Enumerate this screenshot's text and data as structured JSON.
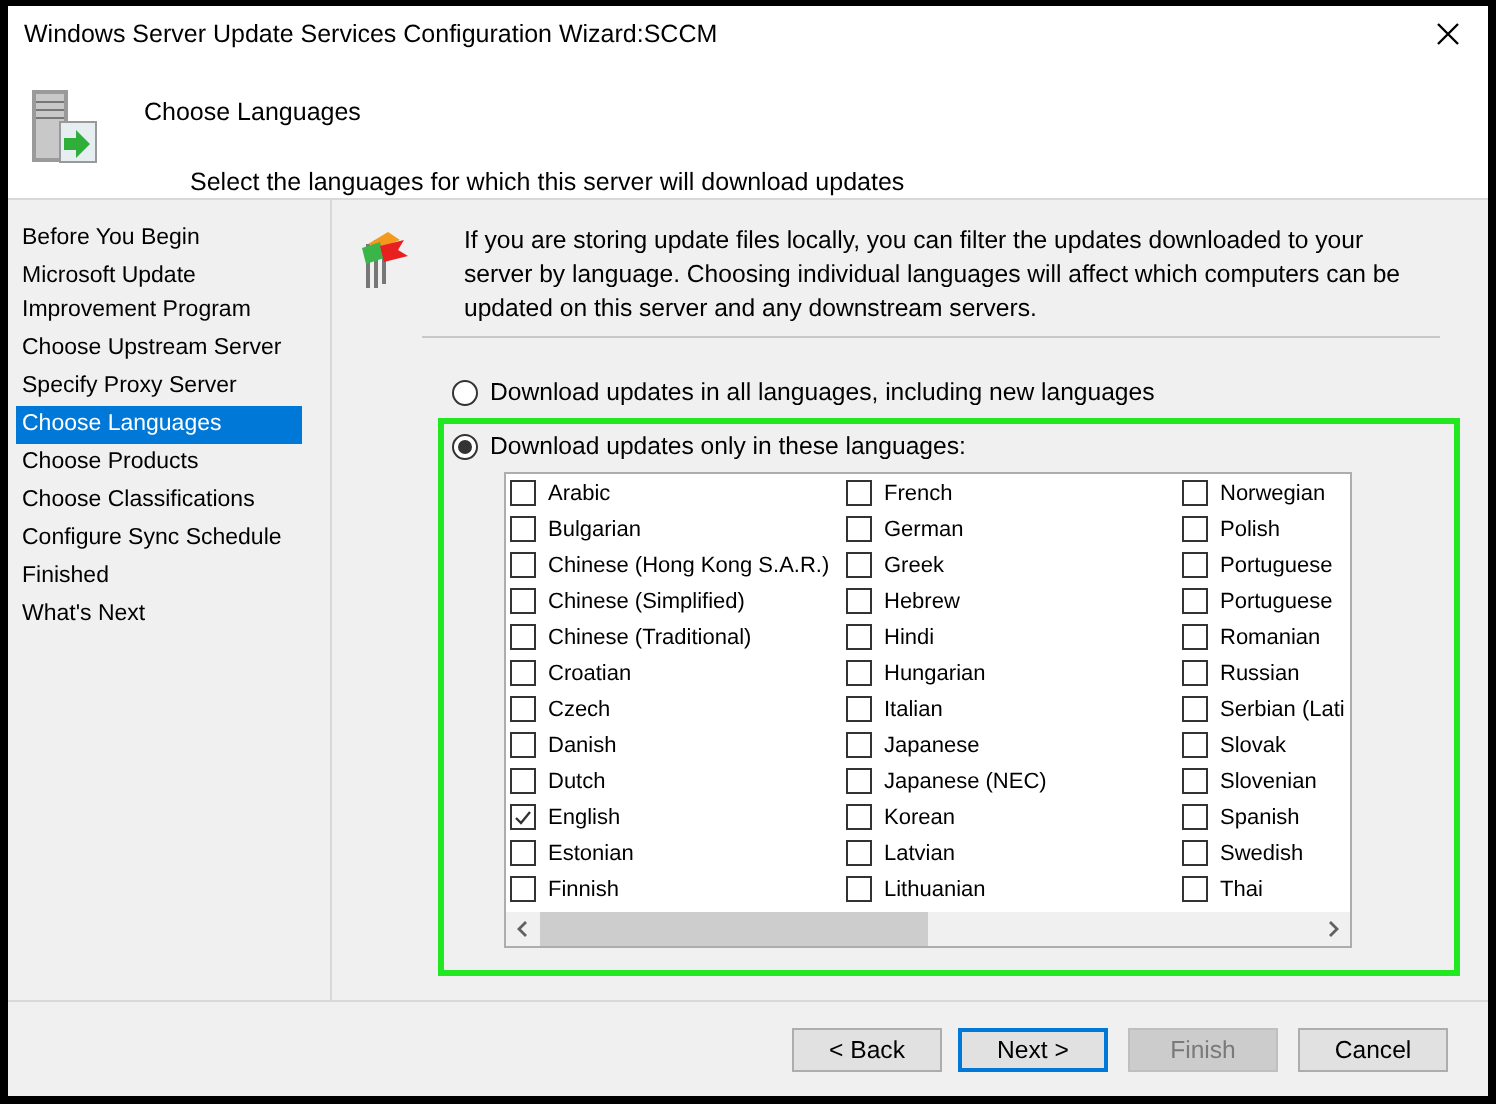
{
  "window": {
    "title": "Windows Server Update Services Configuration Wizard:SCCM"
  },
  "header": {
    "title": "Choose Languages",
    "subtitle": "Select the languages for which this server will download updates"
  },
  "sidebar": {
    "items": [
      {
        "label": "Before You Begin",
        "selected": false
      },
      {
        "label": "Microsoft Update Improvement Program",
        "selected": false
      },
      {
        "label": "Choose Upstream Server",
        "selected": false
      },
      {
        "label": "Specify Proxy Server",
        "selected": false
      },
      {
        "label": "Choose Languages",
        "selected": true
      },
      {
        "label": "Choose Products",
        "selected": false
      },
      {
        "label": "Choose Classifications",
        "selected": false
      },
      {
        "label": "Configure Sync Schedule",
        "selected": false
      },
      {
        "label": "Finished",
        "selected": false
      },
      {
        "label": "What's Next",
        "selected": false
      }
    ]
  },
  "description": "If you are storing update files locally, you can filter the updates downloaded to your server by language. Choosing individual languages will affect which computers can be updated on this server and any downstream servers.",
  "options": [
    {
      "label": "Download updates in all languages, including new languages",
      "selected": false
    },
    {
      "label": "Download updates only in these languages:",
      "selected": true
    }
  ],
  "languages": [
    {
      "label": "Arabic",
      "checked": false
    },
    {
      "label": "Bulgarian",
      "checked": false
    },
    {
      "label": "Chinese (Hong Kong S.A.R.)",
      "checked": false
    },
    {
      "label": "Chinese (Simplified)",
      "checked": false
    },
    {
      "label": "Chinese (Traditional)",
      "checked": false
    },
    {
      "label": "Croatian",
      "checked": false
    },
    {
      "label": "Czech",
      "checked": false
    },
    {
      "label": "Danish",
      "checked": false
    },
    {
      "label": "Dutch",
      "checked": false
    },
    {
      "label": "English",
      "checked": true
    },
    {
      "label": "Estonian",
      "checked": false
    },
    {
      "label": "Finnish",
      "checked": false
    },
    {
      "label": "French",
      "checked": false
    },
    {
      "label": "German",
      "checked": false
    },
    {
      "label": "Greek",
      "checked": false
    },
    {
      "label": "Hebrew",
      "checked": false
    },
    {
      "label": "Hindi",
      "checked": false
    },
    {
      "label": "Hungarian",
      "checked": false
    },
    {
      "label": "Italian",
      "checked": false
    },
    {
      "label": "Japanese",
      "checked": false
    },
    {
      "label": "Japanese (NEC)",
      "checked": false
    },
    {
      "label": "Korean",
      "checked": false
    },
    {
      "label": "Latvian",
      "checked": false
    },
    {
      "label": "Lithuanian",
      "checked": false
    },
    {
      "label": "Norwegian",
      "checked": false
    },
    {
      "label": "Polish",
      "checked": false
    },
    {
      "label": "Portuguese",
      "checked": false
    },
    {
      "label": "Portuguese",
      "checked": false
    },
    {
      "label": "Romanian",
      "checked": false
    },
    {
      "label": "Russian",
      "checked": false
    },
    {
      "label": "Serbian (Lati",
      "checked": false
    },
    {
      "label": "Slovak",
      "checked": false
    },
    {
      "label": "Slovenian",
      "checked": false
    },
    {
      "label": "Spanish",
      "checked": false
    },
    {
      "label": "Swedish",
      "checked": false
    },
    {
      "label": "Thai",
      "checked": false
    }
  ],
  "buttons": [
    {
      "label": "< Back",
      "disabled": false,
      "focused": false
    },
    {
      "label": "Next >",
      "disabled": false,
      "focused": true
    },
    {
      "label": "Finish",
      "disabled": true,
      "focused": false
    },
    {
      "label": "Cancel",
      "disabled": false,
      "focused": false
    }
  ]
}
